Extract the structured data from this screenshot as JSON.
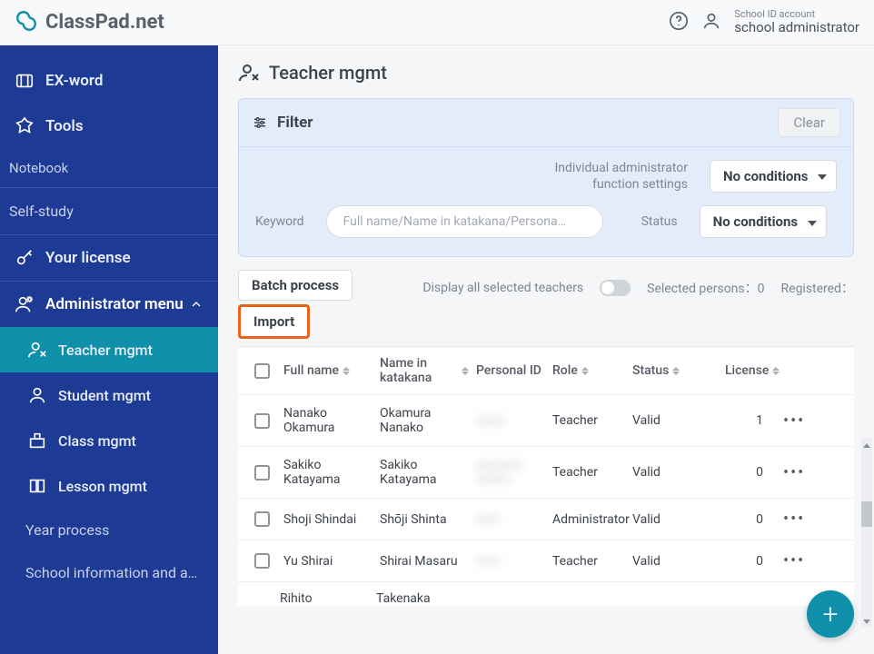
{
  "brand": "ClassPad.net",
  "header": {
    "account_top": "School ID account",
    "account_bottom": "school administrator"
  },
  "sidebar": {
    "exword": "EX-word",
    "tools": "Tools",
    "notebook": "Notebook",
    "selfstudy": "Self-study",
    "license": "Your license",
    "admin": "Administrator menu",
    "teacher_mgmt": "Teacher mgmt",
    "student_mgmt": "Student mgmt",
    "class_mgmt": "Class mgmt",
    "lesson_mgmt": "Lesson mgmt",
    "year": "Year process",
    "school_info": "School information and a…"
  },
  "page": {
    "title": "Teacher mgmt"
  },
  "filter": {
    "title": "Filter",
    "clear": "Clear",
    "admin_setting_label": "Individual administrator function settings",
    "keyword_label": "Keyword",
    "keyword_placeholder": "Full name/Name in katakana/Persona…",
    "status_label": "Status",
    "dropdown_value": "No conditions"
  },
  "toolbar": {
    "batch": "Batch process",
    "import": "Import",
    "display_all": "Display all selected teachers",
    "selected": "Selected persons：0",
    "registered": "Registered："
  },
  "columns": {
    "full_name": "Full name",
    "katakana": "Name in katakana",
    "personal_id": "Personal ID",
    "role": "Role",
    "status": "Status",
    "license": "License"
  },
  "rows": [
    {
      "full_name": "Nanako Okamura",
      "katakana": "Okamura Nanako",
      "pid": "xxxxx",
      "role": "Teacher",
      "status": "Valid",
      "license": "1"
    },
    {
      "full_name": "Sakiko Katayama",
      "katakana": "Sakiko Katayama",
      "pid": "xxxxxxxx xxxxxx",
      "role": "Teacher",
      "status": "Valid",
      "license": "0"
    },
    {
      "full_name": "Shoji Shindai",
      "katakana": "Shōji Shinta",
      "pid": "xxxx",
      "role": "Administrator",
      "status": "Valid",
      "license": "0"
    },
    {
      "full_name": "Yu Shirai",
      "katakana": "Shirai Masaru",
      "pid": "xxxx",
      "role": "Teacher",
      "status": "Valid",
      "license": "0"
    }
  ],
  "partial": {
    "full_name": "Rihito",
    "katakana": "Takenaka"
  }
}
